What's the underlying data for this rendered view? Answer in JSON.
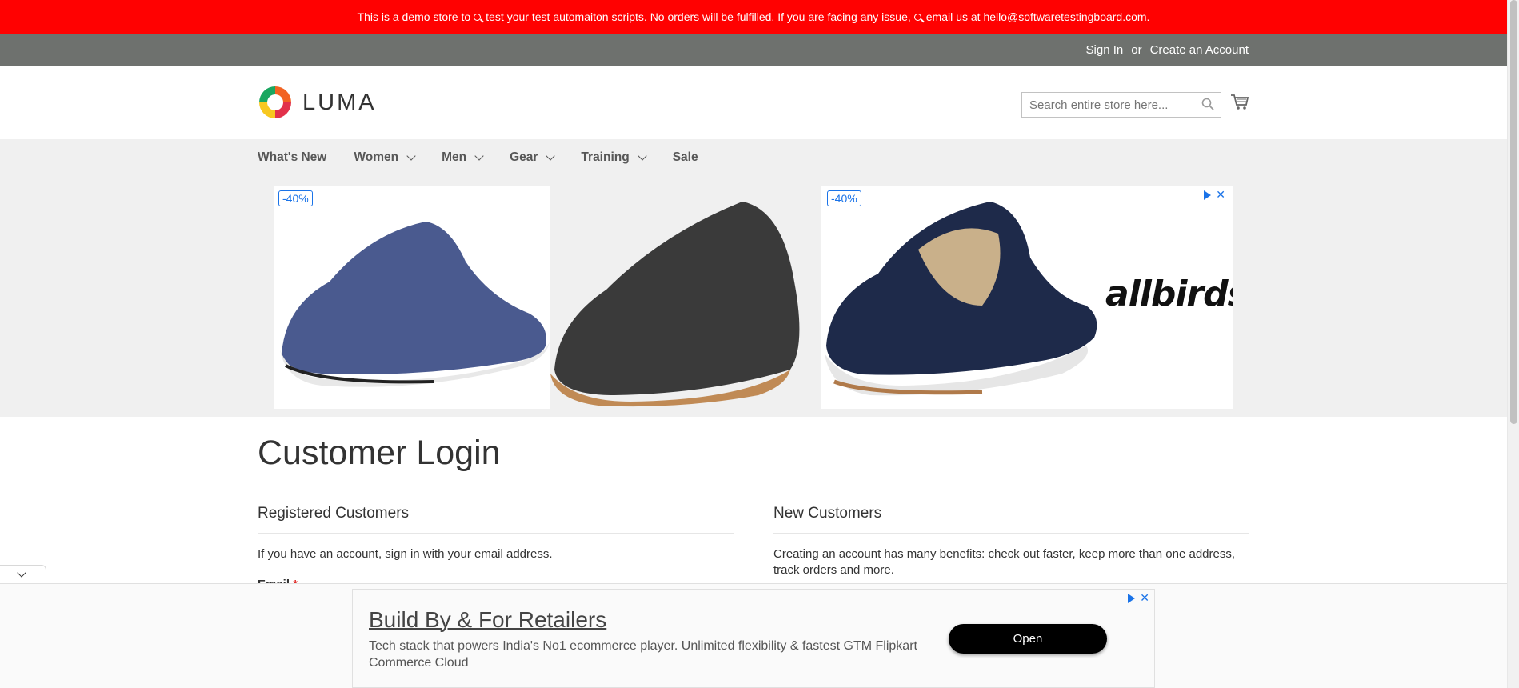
{
  "demo_banner": {
    "text_1": "This is a demo store to",
    "link_1": "test",
    "text_2": "your test automaiton scripts. No orders will be fulfilled. If you are facing any issue,",
    "link_2": "email",
    "text_3": "us at hello@softwaretestingboard.com.",
    "color": "#ff0101"
  },
  "header": {
    "sign_in": "Sign In",
    "or": "or",
    "create_account": "Create an Account",
    "logo_text": "LUMA",
    "search_placeholder": "Search entire store here...",
    "search_icon": "search-icon",
    "cart_icon": "cart-icon"
  },
  "nav": {
    "items": [
      {
        "label": "What's New",
        "has_dropdown": false
      },
      {
        "label": "Women",
        "has_dropdown": true
      },
      {
        "label": "Men",
        "has_dropdown": true
      },
      {
        "label": "Gear",
        "has_dropdown": true
      },
      {
        "label": "Training",
        "has_dropdown": true
      },
      {
        "label": "Sale",
        "has_dropdown": false
      }
    ]
  },
  "ad_banner": {
    "badge_1": "-40%",
    "badge_2": "-40%",
    "brand": "allbirds",
    "close_label": "✕"
  },
  "login": {
    "page_title": "Customer Login",
    "registered": {
      "title": "Registered Customers",
      "text": "If you have an account, sign in with your email address.",
      "email_label": "Email",
      "required_mark": "*"
    },
    "new_customers": {
      "title": "New Customers",
      "text": "Creating an account has many benefits: check out faster, keep more than one address, track orders and more."
    }
  },
  "bottom_ad": {
    "headline": "Build By & For Retailers",
    "description": "Tech stack that powers India's No1 ecommerce player. Unlimited flexibility & fastest GTM Flipkart Commerce Cloud",
    "button": "Open",
    "close_label": "✕"
  }
}
